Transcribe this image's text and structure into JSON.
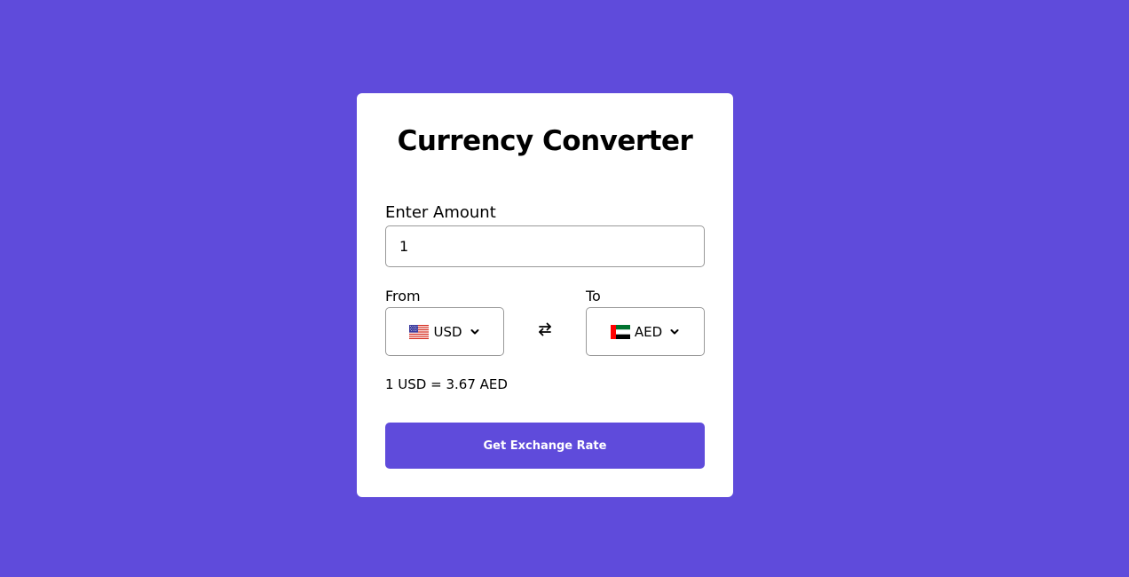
{
  "card": {
    "title": "Currency Converter",
    "amount_label": "Enter Amount",
    "amount_value": "1",
    "from_label": "From",
    "to_label": "To",
    "from_currency": {
      "code": "USD",
      "flag_icon": "us-flag-icon"
    },
    "to_currency": {
      "code": "AED",
      "flag_icon": "ae-flag-icon"
    },
    "swap_icon": "swap-arrows-icon",
    "rate_text": "1 USD = 3.67 AED",
    "button_label": "Get Exchange Rate"
  },
  "colors": {
    "background": "#5f4bdb",
    "card": "#ffffff",
    "accent": "#5f4bdb"
  }
}
